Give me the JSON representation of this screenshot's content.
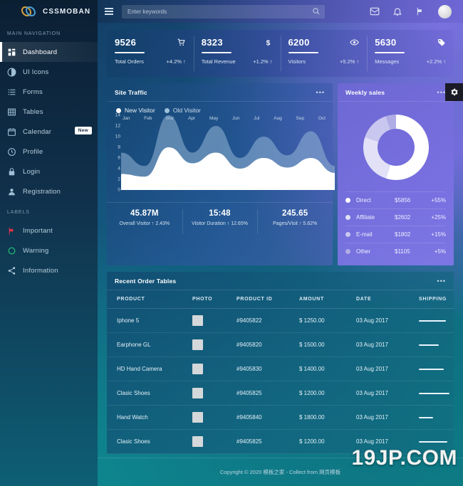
{
  "brand": {
    "name": "CSSMOBAN"
  },
  "sidebar": {
    "nav_heading": "MAIN NAVIGATION",
    "labels_heading": "LABELS",
    "items": [
      {
        "label": "Dashboard",
        "icon": "grid-icon",
        "active": true
      },
      {
        "label": "UI Icons",
        "icon": "contrast-icon",
        "active": false
      },
      {
        "label": "Forms",
        "icon": "list-icon",
        "active": false
      },
      {
        "label": "Tables",
        "icon": "table-icon",
        "active": false
      },
      {
        "label": "Calendar",
        "icon": "calendar-icon",
        "active": false,
        "badge": "New"
      },
      {
        "label": "Profile",
        "icon": "clock-icon",
        "active": false
      },
      {
        "label": "Login",
        "icon": "lock-icon",
        "active": false
      },
      {
        "label": "Registration",
        "icon": "user-icon",
        "active": false
      }
    ],
    "labels": [
      {
        "label": "Important",
        "icon": "flag-icon",
        "color": "#e8314a"
      },
      {
        "label": "Warning",
        "icon": "circle-icon",
        "color": "#21b573"
      },
      {
        "label": "Information",
        "icon": "share-icon",
        "color": "#bcd2e0"
      }
    ]
  },
  "header": {
    "menu_icon": "hamburger-icon",
    "search_placeholder": "Enter keywords",
    "search_value": "",
    "icons": [
      "envelope-icon",
      "bell-icon",
      "flag-icon",
      "avatar"
    ]
  },
  "stats": [
    {
      "value": "9526",
      "label": "Total Orders",
      "change": "+4.2% ↑",
      "icon": "cart-icon"
    },
    {
      "value": "8323",
      "label": "Total Revenue",
      "change": "+1.2% ↑",
      "icon": "dollar-icon"
    },
    {
      "value": "6200",
      "label": "Visitors",
      "change": "+5.2% ↑",
      "icon": "eye-icon"
    },
    {
      "value": "5630",
      "label": "Messages",
      "change": "+2.2% ↑",
      "icon": "tag-icon"
    }
  ],
  "traffic": {
    "title": "Site Traffic",
    "menu_icon": "ellipsis-icon",
    "footer_stats": [
      {
        "value": "45.87M",
        "label": "Overall Visitor ↑ 2.43%"
      },
      {
        "value": "15:48",
        "label": "Visitor Duration ↑ 12.65%"
      },
      {
        "value": "245.65",
        "label": "Pages/Visit ↑ 5.62%"
      }
    ]
  },
  "weekly": {
    "title": "Weekly sales",
    "menu_icon": "ellipsis-icon",
    "gear_icon": "gear-icon",
    "rows": [
      {
        "name": "Direct",
        "amount": "$5856",
        "pct": "+55%",
        "color": "#ffffff"
      },
      {
        "name": "Affiliate",
        "amount": "$2602",
        "pct": "+25%",
        "color": "#e2e1f7"
      },
      {
        "name": "E-mail",
        "amount": "$1802",
        "pct": "+15%",
        "color": "#c9c7ef"
      },
      {
        "name": "Other",
        "amount": "$1105",
        "pct": "+5%",
        "color": "#b0ade6"
      }
    ]
  },
  "orders": {
    "title": "Recent Order Tables",
    "menu_icon": "ellipsis-icon",
    "columns": [
      "PRODUCT",
      "PHOTO",
      "PRODUCT ID",
      "AMOUNT",
      "DATE",
      "SHIPPING"
    ],
    "rows": [
      {
        "product": "Iphone 5",
        "product_id": "#9405822",
        "amount": "$ 1250.00",
        "date": "03 Aug 2017",
        "shipping": 78
      },
      {
        "product": "Earphone GL",
        "product_id": "#9405820",
        "amount": "$ 1500.00",
        "date": "03 Aug 2017",
        "shipping": 58
      },
      {
        "product": "HD Hand Camera",
        "product_id": "#9405830",
        "amount": "$ 1400.00",
        "date": "03 Aug 2017",
        "shipping": 72
      },
      {
        "product": "Clasic Shoes",
        "product_id": "#9405825",
        "amount": "$ 1200.00",
        "date": "03 Aug 2017",
        "shipping": 88
      },
      {
        "product": "Hand Watch",
        "product_id": "#9405840",
        "amount": "$ 1800.00",
        "date": "03 Aug 2017",
        "shipping": 40
      },
      {
        "product": "Clasic Shoes",
        "product_id": "#9405825",
        "amount": "$ 1200.00",
        "date": "03 Aug 2017",
        "shipping": 82
      }
    ]
  },
  "footer": {
    "text": "Copyright © 2020 模板之家 - Collect from 网页模板"
  },
  "watermark": {
    "text": "19JP.COM"
  },
  "chart_data": [
    {
      "type": "area",
      "title": "Site Traffic",
      "xlabel": "",
      "ylabel": "",
      "ylim": [
        0,
        14
      ],
      "yticks": [
        0,
        2,
        4,
        6,
        8,
        10,
        12,
        14
      ],
      "categories": [
        "Jan",
        "Feb",
        "Mar",
        "Apr",
        "May",
        "Jun",
        "Jul",
        "Aug",
        "Sep",
        "Oct"
      ],
      "legend": [
        "New Visitor",
        "Old Visitor"
      ],
      "legend_position": "top-left",
      "grid": false,
      "series": [
        {
          "name": "Old Visitor",
          "color": "#93b6d6",
          "values": [
            7,
            4.5,
            14,
            7,
            12,
            6,
            10,
            6.5,
            11,
            4.5
          ]
        },
        {
          "name": "New Visitor",
          "color": "#ffffff",
          "values": [
            3,
            2.5,
            8,
            5,
            7,
            4,
            6,
            4.2,
            6,
            3.2
          ]
        }
      ]
    },
    {
      "type": "pie",
      "title": "Weekly sales",
      "donut": true,
      "labels": [
        "Direct",
        "Affiliate",
        "E-mail",
        "Other"
      ],
      "values": [
        55,
        25,
        15,
        5
      ],
      "amounts": [
        "$5856",
        "$2602",
        "$1802",
        "$1105"
      ],
      "colors": [
        "#ffffff",
        "#e2e1f7",
        "#c9c7ef",
        "#b0ade6"
      ]
    }
  ]
}
